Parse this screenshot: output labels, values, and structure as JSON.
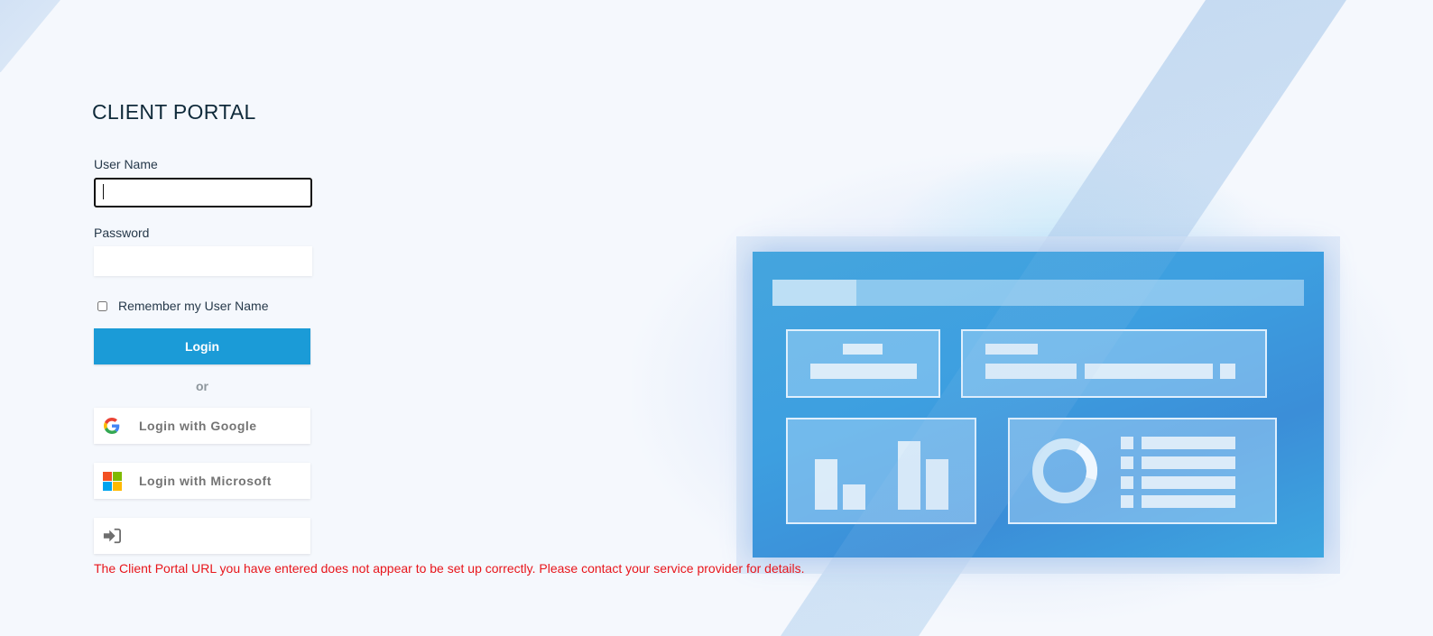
{
  "page": {
    "title": "CLIENT PORTAL"
  },
  "form": {
    "username_label": "User Name",
    "username_value": "",
    "password_label": "Password",
    "password_value": "",
    "remember_label": "Remember my User Name",
    "remember_checked": false,
    "login_label": "Login",
    "or_label": "or",
    "google_label": "Login with Google",
    "microsoft_label": "Login with Microsoft",
    "other_login_label": ""
  },
  "error": {
    "message": "The Client Portal URL you have entered does not appear to be set up correctly. Please contact your service provider for details."
  },
  "icons": {
    "google": "google-logo-icon",
    "microsoft": "microsoft-logo-icon",
    "sign_in": "sign-in-icon"
  },
  "colors": {
    "primary": "#1b9bd7",
    "error": "#e8151b",
    "title": "#0f2a3a",
    "background": "#f5f8fd"
  }
}
